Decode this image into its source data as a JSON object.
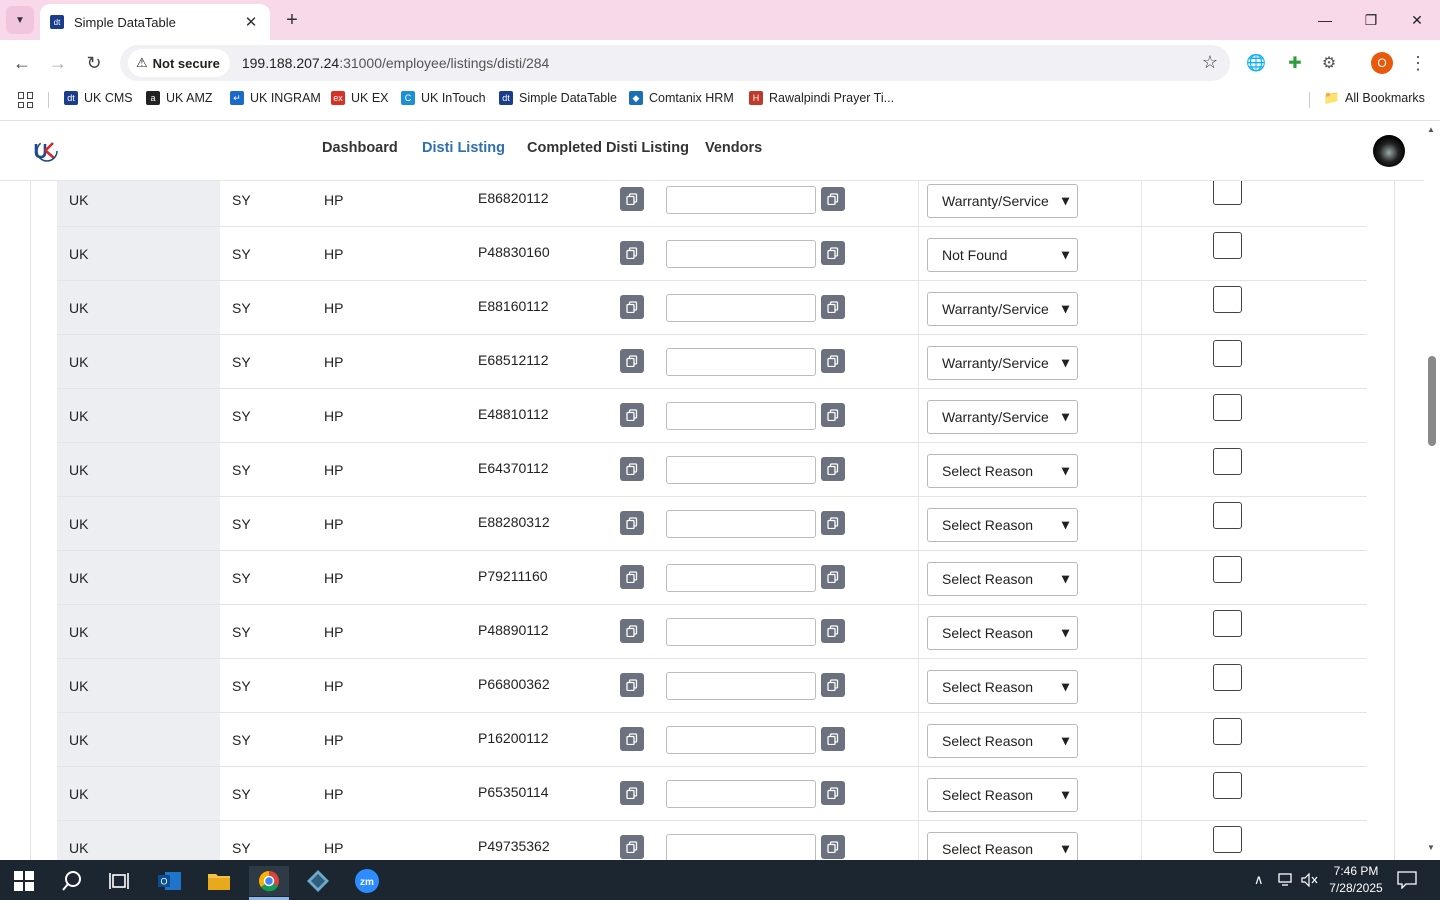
{
  "browser": {
    "tab_title": "Simple DataTable",
    "tab_favicon_text": "dt",
    "security_label": "Not secure",
    "url_host": "199.188.207.24",
    "url_path": ":31000/employee/listings/disti/284",
    "profile_initial": "O",
    "bookmarks": [
      {
        "label": "UK CMS",
        "color": "#1a3e8c"
      },
      {
        "label": "UK AMZ",
        "color": "#222222"
      },
      {
        "label": "UK INGRAM",
        "color": "#1b6ac9"
      },
      {
        "label": "UK EX",
        "color": "#d93025"
      },
      {
        "label": "UK InTouch",
        "color": "#1e8fd6"
      },
      {
        "label": "Simple DataTable",
        "color": "#1a3e8c"
      },
      {
        "label": "Comtanix HRM",
        "color": "#1a6fb5"
      },
      {
        "label": "Rawalpindi Prayer Ti...",
        "color": "#c0392b"
      }
    ],
    "all_bookmarks_label": "All Bookmarks"
  },
  "nav": {
    "items": [
      {
        "label": "Dashboard",
        "active": false
      },
      {
        "label": "Disti Listing",
        "active": true
      },
      {
        "label": "Completed Disti Listing",
        "active": false
      },
      {
        "label": "Vendors",
        "active": false
      }
    ]
  },
  "rows": [
    {
      "country": "UK",
      "supplier": "SY",
      "brand": "HP",
      "part": "E86820112",
      "reason": "Warranty/Service"
    },
    {
      "country": "UK",
      "supplier": "SY",
      "brand": "HP",
      "part": "P48830160",
      "reason": "Not Found"
    },
    {
      "country": "UK",
      "supplier": "SY",
      "brand": "HP",
      "part": "E88160112",
      "reason": "Warranty/Service"
    },
    {
      "country": "UK",
      "supplier": "SY",
      "brand": "HP",
      "part": "E68512112",
      "reason": "Warranty/Service"
    },
    {
      "country": "UK",
      "supplier": "SY",
      "brand": "HP",
      "part": "E48810112",
      "reason": "Warranty/Service"
    },
    {
      "country": "UK",
      "supplier": "SY",
      "brand": "HP",
      "part": "E64370112",
      "reason": "Select Reason"
    },
    {
      "country": "UK",
      "supplier": "SY",
      "brand": "HP",
      "part": "E88280312",
      "reason": "Select Reason"
    },
    {
      "country": "UK",
      "supplier": "SY",
      "brand": "HP",
      "part": "P79211160",
      "reason": "Select Reason"
    },
    {
      "country": "UK",
      "supplier": "SY",
      "brand": "HP",
      "part": "P48890112",
      "reason": "Select Reason"
    },
    {
      "country": "UK",
      "supplier": "SY",
      "brand": "HP",
      "part": "P66800362",
      "reason": "Select Reason"
    },
    {
      "country": "UK",
      "supplier": "SY",
      "brand": "HP",
      "part": "P16200112",
      "reason": "Select Reason"
    },
    {
      "country": "UK",
      "supplier": "SY",
      "brand": "HP",
      "part": "P65350114",
      "reason": "Select Reason"
    },
    {
      "country": "UK",
      "supplier": "SY",
      "brand": "HP",
      "part": "P49735362",
      "reason": "Select Reason"
    }
  ],
  "taskbar": {
    "time": "7:46 PM",
    "date": "7/28/2025"
  },
  "colors": {
    "accent": "#2e6fb2",
    "tab_strip": "#f8d9e9",
    "copy_button": "#6c7180",
    "taskbar": "#1c2630"
  }
}
